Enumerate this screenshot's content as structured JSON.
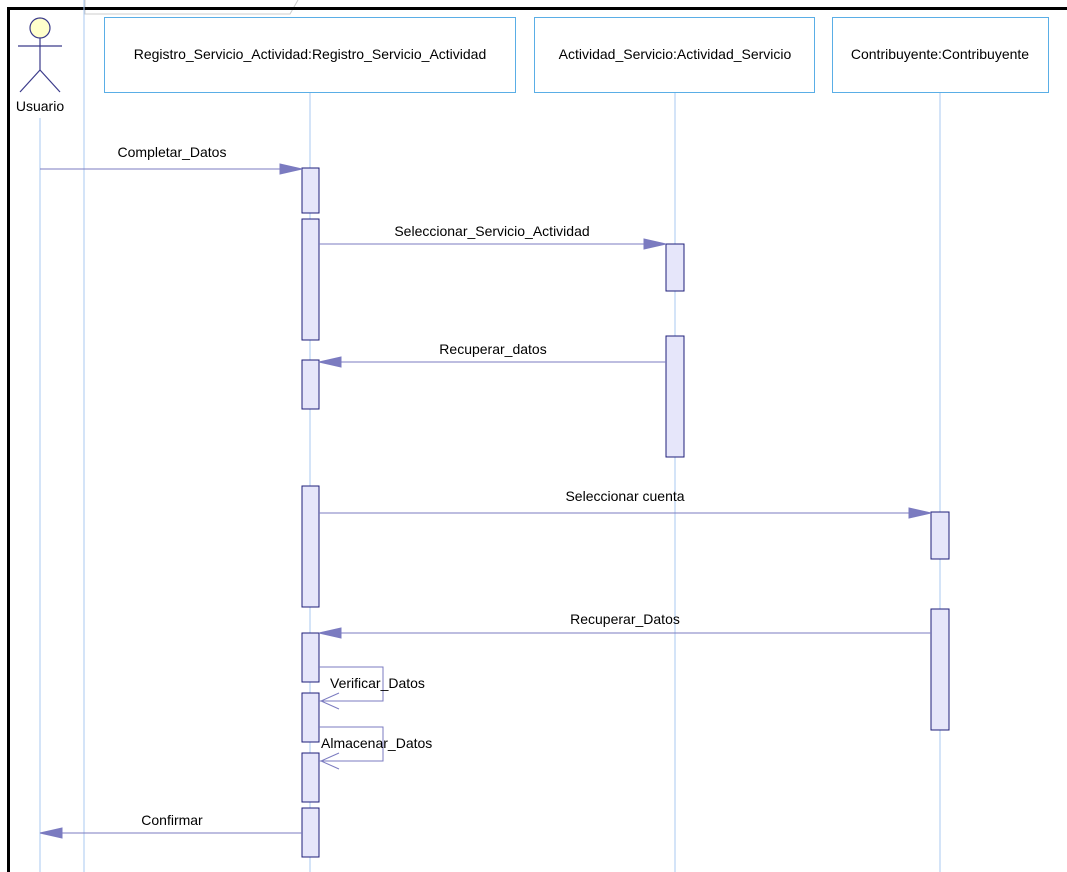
{
  "diagram": {
    "type": "uml-sequence",
    "colors": {
      "lifeline": "#a9c9f2",
      "box_border": "#5aaee6",
      "activation_fill": "#e6e6fa",
      "activation_border": "#1f1f7a",
      "message": "#7b7bc0",
      "actor_head": "#ffffcc",
      "frame": "#000000"
    },
    "actor": {
      "label": "Usuario",
      "icon": "stick-figure-actor-icon"
    },
    "participants": [
      {
        "label": "Registro_Servicio_Actividad:Registro_Servicio_Actividad"
      },
      {
        "label": "Actividad_Servicio:Actividad_Servicio"
      },
      {
        "label": "Contribuyente:Contribuyente"
      }
    ],
    "messages": [
      {
        "label": "Completar_Datos",
        "from": "Usuario",
        "to": "Registro_Servicio_Actividad"
      },
      {
        "label": "Seleccionar_Servicio_Actividad",
        "from": "Registro_Servicio_Actividad",
        "to": "Actividad_Servicio"
      },
      {
        "label": "Recuperar_datos",
        "from": "Actividad_Servicio",
        "to": "Registro_Servicio_Actividad"
      },
      {
        "label": "Seleccionar cuenta",
        "from": "Registro_Servicio_Actividad",
        "to": "Contribuyente"
      },
      {
        "label": "Recuperar_Datos",
        "from": "Contribuyente",
        "to": "Registro_Servicio_Actividad"
      },
      {
        "label": "Verificar_Datos",
        "from": "Registro_Servicio_Actividad",
        "to": "Registro_Servicio_Actividad"
      },
      {
        "label": "Almacenar_Datos",
        "from": "Registro_Servicio_Actividad",
        "to": "Registro_Servicio_Actividad"
      },
      {
        "label": "Confirmar",
        "from": "Registro_Servicio_Actividad",
        "to": "Usuario"
      }
    ]
  }
}
